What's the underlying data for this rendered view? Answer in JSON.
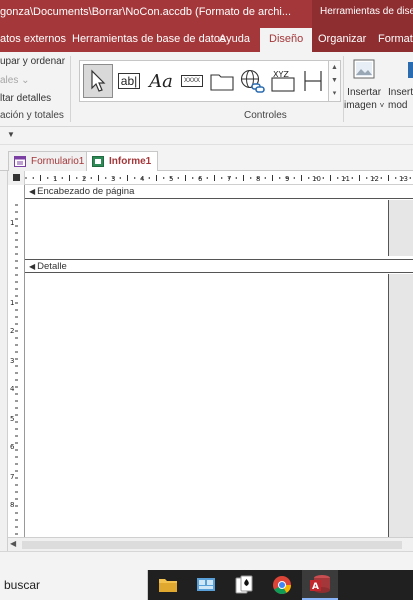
{
  "title_bar": {
    "path": "gonza\\Documents\\Borrar\\NoCon.accdb (Formato de archi...",
    "tools_label": "Herramientas de diseño"
  },
  "tabs": [
    {
      "label": "atos externos"
    },
    {
      "label": "Herramientas de base de datos"
    },
    {
      "label": "Ayuda"
    },
    {
      "label": "Diseño"
    },
    {
      "label": "Organizar"
    },
    {
      "label": "Formato"
    }
  ],
  "ribbon": {
    "group_sort": "upar y ordenar",
    "totals_dim": "ales",
    "hide_details": "ltar detalles",
    "group_label_left": "ación y totales",
    "controls_label": "Controles",
    "text_control_label": "ab|",
    "label_control_label": "Aa",
    "button_control_label": "XXXX",
    "xyz_label": "XYZ",
    "insert_image_line1": "Insertar",
    "insert_image_line2": "imagen",
    "insert_mod_line1": "Inserta",
    "insert_mod_line2": "mod"
  },
  "doc_tabs": [
    {
      "label": "Formulario1",
      "active": false
    },
    {
      "label": "Informe1",
      "active": true
    }
  ],
  "ruler": {
    "numbers": [
      "1",
      "2",
      "3",
      "4",
      "5",
      "6",
      "7",
      "8",
      "9",
      "10",
      "11",
      "12",
      "13"
    ],
    "left_numbers": [
      "1",
      "1",
      "2",
      "3",
      "4",
      "5",
      "6",
      "7",
      "8"
    ]
  },
  "sections": {
    "page_header": "Encabezado de página",
    "detail": "Detalle"
  },
  "taskbar": {
    "search_text": "buscar"
  },
  "colors": {
    "accent": "#a4373a"
  }
}
